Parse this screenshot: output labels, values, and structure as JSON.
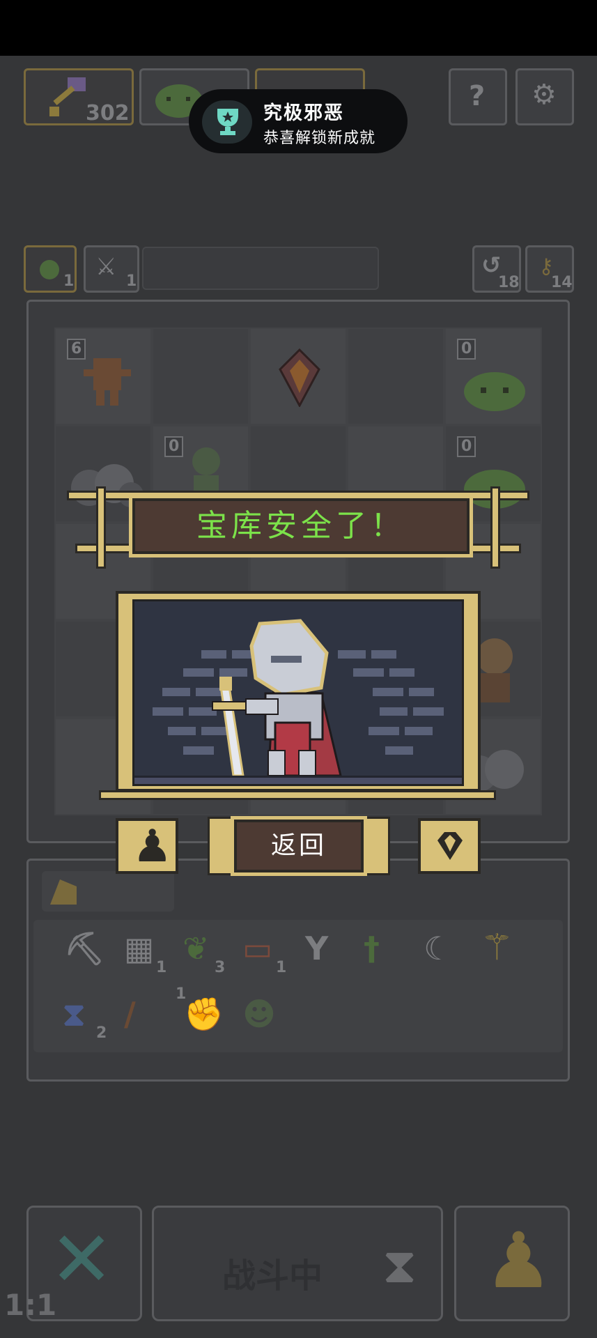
{
  "hud": {
    "weapon_count": "302",
    "recruit_count": "1",
    "skill_count": "1",
    "revive_count": "18",
    "key_count": "14"
  },
  "toast": {
    "title": "究极邪恶",
    "subtitle": "恭喜解锁新成就"
  },
  "grid": {
    "badges": [
      "6",
      "0",
      "0",
      "0"
    ]
  },
  "popup": {
    "title": "宝库安全了！",
    "back_label": "返回"
  },
  "inventory": {
    "counts": [
      "1",
      "3",
      "1",
      "2",
      "1"
    ]
  },
  "bottom": {
    "status_label": "战斗中",
    "speed_label": "1:1"
  },
  "colors": {
    "gold": "#d8c179",
    "title_green": "#7ce24a",
    "panel_brown": "#4d3a33",
    "dark_outline": "#2b2925",
    "background": "#353638"
  }
}
